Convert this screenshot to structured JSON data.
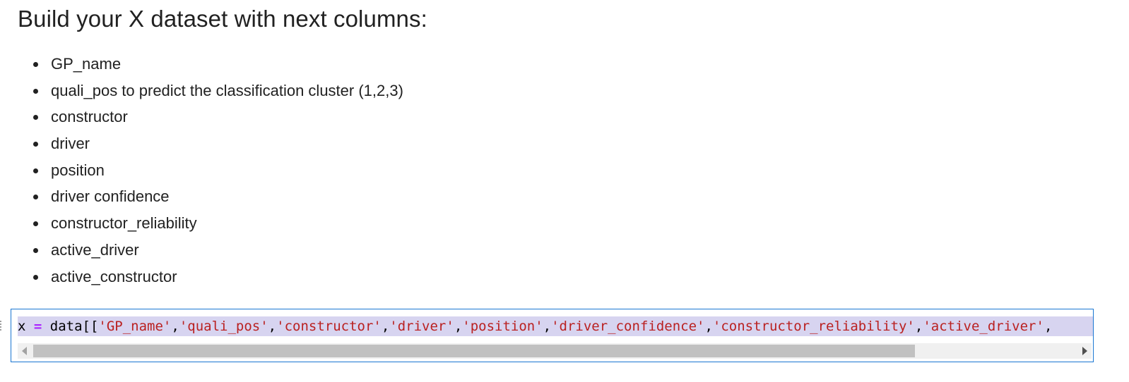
{
  "markdown": {
    "heading": "Build your X dataset with next columns:",
    "items": [
      "GP_name",
      "quali_pos to predict the classification cluster (1,2,3)",
      "constructor",
      "driver",
      "position",
      "driver confidence",
      "constructor_reliability",
      "active_driver",
      "active_constructor"
    ]
  },
  "code_cell": {
    "var": "x ",
    "op": "=",
    "call": " data[[",
    "strings": [
      "'GP_name'",
      "'quali_pos'",
      "'constructor'",
      "'driver'",
      "'position'",
      "'driver_confidence'",
      "'constructor_reliability'",
      "'active_driver'"
    ],
    "separator": ",",
    "trailing": ","
  },
  "scrollbar": {
    "position_fraction": 0.0,
    "visible_fraction": 0.82
  },
  "colors": {
    "cell_border": "#1976d2",
    "selection_highlight": "#d7d4f0",
    "string": "#ba2121",
    "operator": "#aa22ff"
  }
}
